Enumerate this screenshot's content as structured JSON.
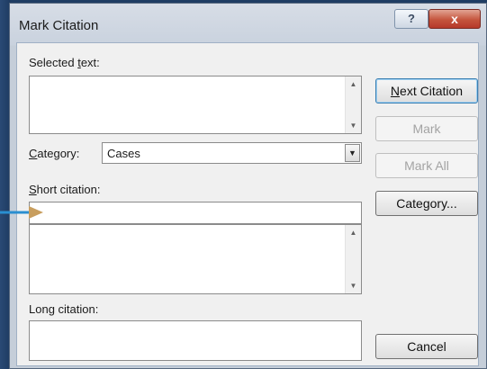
{
  "dialog": {
    "title": "Mark Citation",
    "help_glyph": "?",
    "close_glyph": "x"
  },
  "fields": {
    "selected_text": {
      "label_prefix": "Selected ",
      "label_key": "t",
      "label_suffix": "ext:",
      "value": ""
    },
    "category": {
      "label_key": "C",
      "label_suffix": "ategory:",
      "value": "Cases"
    },
    "short_citation": {
      "label_key": "S",
      "label_suffix": "hort citation:",
      "value": ""
    },
    "long_citation": {
      "label": "Long citation:",
      "value": ""
    }
  },
  "buttons": {
    "next_citation": {
      "label_key": "N",
      "label_suffix": "ext Citation"
    },
    "mark": {
      "label": "Mark"
    },
    "mark_all": {
      "label": "Mark All"
    },
    "category": {
      "label_prefix": "Category",
      "label_suffix": "..."
    },
    "cancel": {
      "label": "Cancel"
    }
  },
  "colors": {
    "annotation_arrow": "#2a8fd0",
    "annotation_arrow_tip": "#c89e5e"
  },
  "icons": {
    "scroll_up": "▲",
    "scroll_down": "▼",
    "dropdown": "▼",
    "annotation": "right-arrow-icon"
  }
}
